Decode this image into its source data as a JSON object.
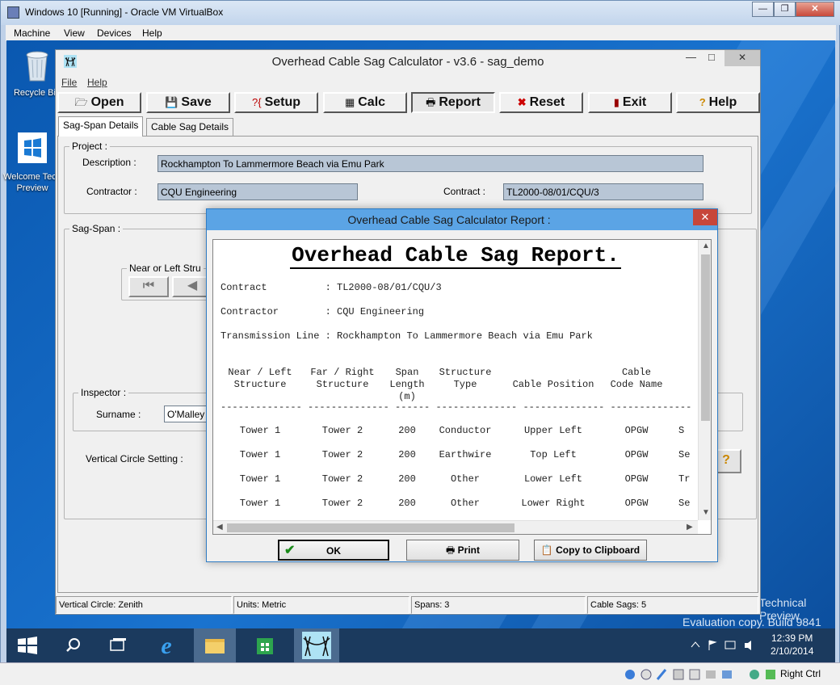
{
  "vbox": {
    "title": "Windows 10 [Running] - Oracle VM VirtualBox",
    "menu": [
      "Machine",
      "View",
      "Devices",
      "Help"
    ],
    "status_key": "Right Ctrl"
  },
  "desktop": {
    "icons": [
      {
        "label": "Recycle Bin",
        "icon": "recycle-bin-icon"
      },
      {
        "label": "Welcome Tech Preview",
        "icon": "windows-logo-icon"
      }
    ],
    "watermark_line1": "Technical Preview",
    "watermark_line2": "Evaluation copy. Build 9841"
  },
  "taskbar": {
    "items": [
      "start-icon",
      "search-icon",
      "task-view-icon",
      "internet-explorer-icon",
      "file-explorer-icon",
      "store-icon",
      "sag-calculator-icon"
    ],
    "time": "12:39 PM",
    "date": "2/10/2014"
  },
  "app": {
    "title": "Overhead Cable Sag Calculator - v3.6  -  sag_demo",
    "menu": {
      "file": "File",
      "help": "Help"
    },
    "toolbar": {
      "open": "Open",
      "save": "Save",
      "setup": "Setup",
      "calc": "Calc",
      "report": "Report",
      "reset": "Reset",
      "exit": "Exit",
      "help": "Help"
    },
    "tabs": {
      "sag_span": "Sag-Span Details",
      "cable_sag": "Cable Sag Details"
    },
    "project": {
      "group_label": "Project :",
      "description_label": "Description :",
      "description": "Rockhampton To Lammermore Beach via Emu Park",
      "contractor_label": "Contractor :",
      "contractor": "CQU Engineering",
      "contract_label": "Contract :",
      "contract": "TL2000-08/01/CQU/3"
    },
    "sag_span": {
      "group_label": "Sag-Span :",
      "near_left_label": "Near or Left Stru",
      "inspector_label": "Inspector :",
      "surname_label": "Surname :",
      "surname": "O'Malley",
      "vertical_circle_label": "Vertical Circle Setting :"
    },
    "status": {
      "vertical_circle": "Vertical Circle: Zenith",
      "units": "Units: Metric",
      "spans": "Spans: 3",
      "cable_sags": "Cable Sags: 5"
    }
  },
  "dialog": {
    "title": "Overhead Cable Sag Calculator Report :",
    "heading": "Overhead Cable Sag Report.",
    "contract_line": "Contract          : TL2000-08/01/CQU/3",
    "contractor_line": "Contractor        : CQU Engineering",
    "line_line": "Transmission Line : Rockhampton To Lammermore Beach via Emu Park",
    "columns": [
      {
        "l1": "Near / Left",
        "l2": "Structure",
        "l3": ""
      },
      {
        "l1": "Far / Right",
        "l2": "Structure",
        "l3": ""
      },
      {
        "l1": "Span",
        "l2": "Length",
        "l3": "(m)"
      },
      {
        "l1": "Structure",
        "l2": "Type",
        "l3": ""
      },
      {
        "l1": "",
        "l2": "Cable Position",
        "l3": ""
      },
      {
        "l1": "Cable",
        "l2": "Code Name",
        "l3": ""
      }
    ],
    "separator": "-------------- -------------- ------ -------------- -------------- -------------- --",
    "rows": [
      [
        "Tower 1",
        "Tower 2",
        "200",
        "Conductor",
        "Upper Left",
        "OPGW",
        "S"
      ],
      [
        "Tower 1",
        "Tower 2",
        "200",
        "Earthwire",
        "Top Left",
        "OPGW",
        "Se"
      ],
      [
        "Tower 1",
        "Tower 2",
        "200",
        "Other",
        "Lower Left",
        "OPGW",
        "Tr"
      ],
      [
        "Tower 1",
        "Tower 2",
        "200",
        "Other",
        "Lower Right",
        "OPGW",
        "Se"
      ]
    ],
    "buttons": {
      "ok": "OK",
      "print": "Print",
      "copy": "Copy to Clipboard"
    }
  }
}
